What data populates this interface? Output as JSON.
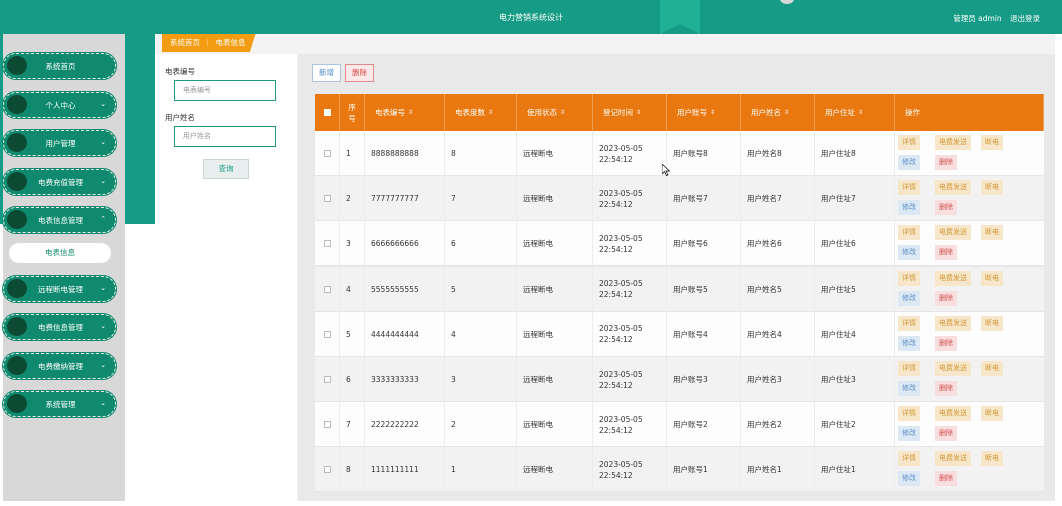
{
  "header": {
    "app_title": "电力营销系统设计",
    "user_label": "管理员 admin",
    "logout": "退出登录"
  },
  "sidebar": {
    "items": [
      {
        "label": "系统首页",
        "has_arrow": false
      },
      {
        "label": "个人中心",
        "has_arrow": true
      },
      {
        "label": "用户管理",
        "has_arrow": true
      },
      {
        "label": "电费充值管理",
        "has_arrow": true
      },
      {
        "label": "电表信息管理",
        "has_arrow": true,
        "expanded": true
      },
      {
        "label": "远程断电管理",
        "has_arrow": true
      },
      {
        "label": "电费信息管理",
        "has_arrow": true
      },
      {
        "label": "电费缴纳管理",
        "has_arrow": true
      },
      {
        "label": "系统管理",
        "has_arrow": true
      }
    ],
    "sub_item": "电表信息"
  },
  "breadcrumb": {
    "home": "系统首页",
    "current": "电表信息"
  },
  "search": {
    "meter_no_label": "电表编号",
    "meter_no_placeholder": "电表编号",
    "user_name_label": "用户姓名",
    "user_name_placeholder": "用户姓名",
    "query_button": "查询"
  },
  "toolbar": {
    "add": "新增",
    "delete": "删除"
  },
  "table": {
    "columns": [
      "序号",
      "电表编号",
      "电表度数",
      "使用状态",
      "登记时间",
      "用户账号",
      "用户姓名",
      "用户住址",
      "操作"
    ],
    "rows": [
      {
        "index": "1",
        "meter_no": "8888888888",
        "reading": "8",
        "status": "远程断电",
        "time": "2023-05-05 22:54:12",
        "account": "用户账号8",
        "name": "用户姓名8",
        "address": "用户住址8"
      },
      {
        "index": "2",
        "meter_no": "7777777777",
        "reading": "7",
        "status": "远程断电",
        "time": "2023-05-05 22:54:12",
        "account": "用户账号7",
        "name": "用户姓名7",
        "address": "用户住址7"
      },
      {
        "index": "3",
        "meter_no": "6666666666",
        "reading": "6",
        "status": "远程断电",
        "time": "2023-05-05 22:54:12",
        "account": "用户账号6",
        "name": "用户姓名6",
        "address": "用户住址6"
      },
      {
        "index": "4",
        "meter_no": "5555555555",
        "reading": "5",
        "status": "远程断电",
        "time": "2023-05-05 22:54:12",
        "account": "用户账号5",
        "name": "用户姓名5",
        "address": "用户住址5"
      },
      {
        "index": "5",
        "meter_no": "4444444444",
        "reading": "4",
        "status": "远程断电",
        "time": "2023-05-05 22:54:12",
        "account": "用户账号4",
        "name": "用户姓名4",
        "address": "用户住址4"
      },
      {
        "index": "6",
        "meter_no": "3333333333",
        "reading": "3",
        "status": "远程断电",
        "time": "2023-05-05 22:54:12",
        "account": "用户账号3",
        "name": "用户姓名3",
        "address": "用户住址3"
      },
      {
        "index": "7",
        "meter_no": "2222222222",
        "reading": "2",
        "status": "远程断电",
        "time": "2023-05-05 22:54:12",
        "account": "用户账号2",
        "name": "用户姓名2",
        "address": "用户住址2"
      },
      {
        "index": "8",
        "meter_no": "1111111111",
        "reading": "1",
        "status": "远程断电",
        "time": "2023-05-05 22:54:12",
        "account": "用户账号1",
        "name": "用户姓名1",
        "address": "用户住址1"
      }
    ],
    "actions": {
      "detail": "详情",
      "send_fee": "电费发送",
      "cut_power": "断电",
      "edit": "修改",
      "delete": "删除"
    }
  },
  "colors": {
    "primary": "#169c86",
    "header_orange": "#e8780f",
    "breadcrumb": "#f39c12"
  }
}
